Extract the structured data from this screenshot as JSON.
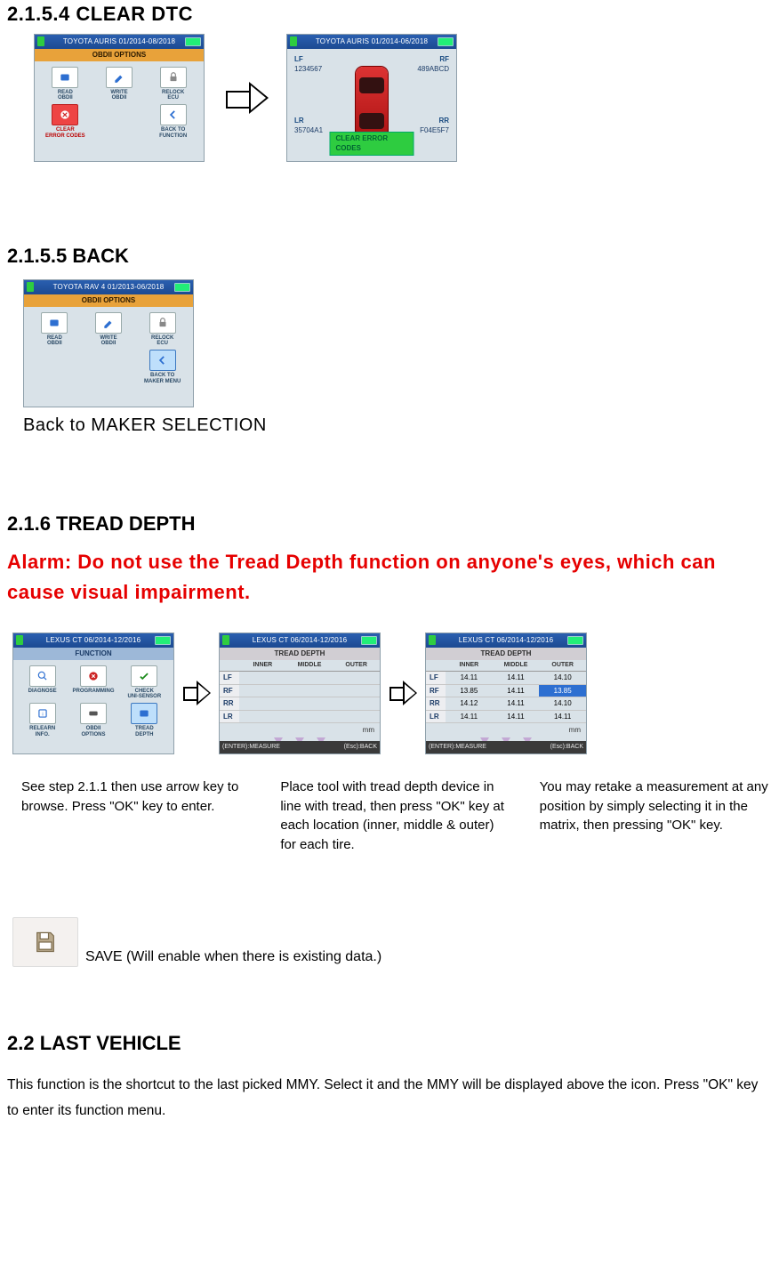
{
  "sec_clear": {
    "heading": "2.1.5.4 CLEAR DTC"
  },
  "clear_screen1": {
    "title": "TOYOTA AURIS 01/2014-08/2018",
    "subtitle": "OBDII OPTIONS",
    "items": [
      {
        "label": "READ\nOBDII"
      },
      {
        "label": "WRITE\nOBDII"
      },
      {
        "label": "RELOCK\nECU"
      },
      {
        "label": "CLEAR\nERROR CODES",
        "style": "red"
      },
      {
        "label": ""
      },
      {
        "label": "BACK TO\nFUNCTION"
      }
    ]
  },
  "clear_screen2": {
    "title": "TOYOTA AURIS 01/2014-06/2018",
    "tl_lbl": "LF",
    "tl_val": "1234567",
    "tr_lbl": "RF",
    "tr_val": "489ABCD",
    "bl_lbl": "LR",
    "bl_val": "35704A1",
    "br_lbl": "RR",
    "br_val": "F04E5F7",
    "button": "CLEAR ERROR CODES"
  },
  "sec_back": {
    "heading": "2.1.5.5 BACK",
    "subtext": "Back to MAKER SELECTION"
  },
  "back_screen": {
    "title": "TOYOTA RAV 4  01/2013-06/2018",
    "subtitle": "OBDII OPTIONS",
    "items": [
      {
        "label": "READ\nOBDII"
      },
      {
        "label": "WRITE\nOBDII"
      },
      {
        "label": "RELOCK\nECU"
      },
      {
        "label": ""
      },
      {
        "label": ""
      },
      {
        "label": "BACK TO\nMAKER MENU",
        "style": "sel"
      }
    ]
  },
  "sec_tread": {
    "heading": "2.1.6 TREAD DEPTH",
    "alarm": "Alarm: Do not use the Tread Depth function on anyone's eyes, which can cause visual impairment."
  },
  "tread_screen1": {
    "title": "LEXUS CT 06/2014-12/2016",
    "subtitle": "FUNCTION",
    "items": [
      {
        "label": "DIAGNOSE"
      },
      {
        "label": "PROGRAMMING"
      },
      {
        "label": "CHECK\nUNI-SENSOR"
      },
      {
        "label": "RELEARN\nINFO."
      },
      {
        "label": "OBDII\nOPTIONS"
      },
      {
        "label": "TREAD\nDEPTH",
        "style": "sel"
      }
    ]
  },
  "tread_screen2": {
    "title": "LEXUS CT 06/2014-12/2016",
    "subtitle": "TREAD DEPTH",
    "cols": [
      "",
      "INNER",
      "MIDDLE",
      "OUTER"
    ],
    "rows": [
      {
        "label": "LF",
        "inner": "",
        "middle": "",
        "outer": ""
      },
      {
        "label": "RF",
        "inner": "",
        "middle": "",
        "outer": ""
      },
      {
        "label": "RR",
        "inner": "",
        "middle": "",
        "outer": ""
      },
      {
        "label": "LR",
        "inner": "",
        "middle": "",
        "outer": ""
      }
    ],
    "unit": "mm",
    "save": "0",
    "enter": "(ENTER):MEASURE",
    "esc": "(Esc):BACK"
  },
  "tread_screen3": {
    "title": "LEXUS CT 06/2014-12/2016",
    "subtitle": "TREAD DEPTH",
    "cols": [
      "",
      "INNER",
      "MIDDLE",
      "OUTER"
    ],
    "rows": [
      {
        "label": "LF",
        "inner": "14.11",
        "middle": "14.11",
        "outer": "14.10"
      },
      {
        "label": "RF",
        "inner": "13.85",
        "middle": "14.11",
        "outer": "13.85",
        "hi": "outer"
      },
      {
        "label": "RR",
        "inner": "14.12",
        "middle": "14.11",
        "outer": "14.10"
      },
      {
        "label": "LR",
        "inner": "14.11",
        "middle": "14.11",
        "outer": "14.11"
      }
    ],
    "unit": "mm",
    "save": "0",
    "enter": "(ENTER):MEASURE",
    "esc": "(Esc):BACK"
  },
  "tread_caps": [
    "See step 2.1.1 then use arrow key to browse. Press \"OK\" key to enter.",
    "Place tool with tread depth device in line with tread, then press \"OK\" key at each location (inner, middle & outer) for each tire.",
    "You may retake a measurement at any position by simply selecting it in the matrix, then pressing \"OK\" key."
  ],
  "save_note": "SAVE (Will enable when there is existing data.)",
  "sec_last": {
    "heading": "2.2 LAST VEHICLE",
    "body": "This function is the shortcut to the last picked MMY. Select it and the MMY will be displayed above the icon. Press \"OK\" key to enter its function menu."
  }
}
